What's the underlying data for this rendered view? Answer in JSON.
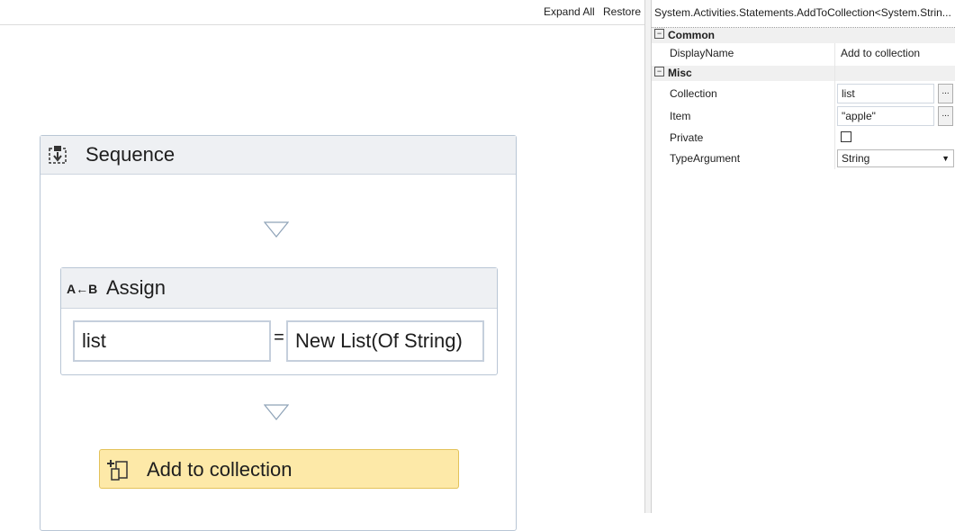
{
  "toolbar": {
    "expand_all": "Expand All",
    "restore": "Restore"
  },
  "sequence": {
    "title": "Sequence",
    "icon": "sequence-icon"
  },
  "assign": {
    "title": "Assign",
    "icon_text": "A←B",
    "to_value": "list",
    "equals": "=",
    "value": "New List(Of String)"
  },
  "add_to_collection": {
    "title": "Add to collection",
    "icon": "add-to-collection-icon"
  },
  "properties": {
    "title": "System.Activities.Statements.AddToCollection<System.Strin...",
    "categories": [
      {
        "label": "Common",
        "toggle": "⊟"
      },
      {
        "label": "Misc",
        "toggle": "⊟"
      }
    ],
    "display_name": {
      "label": "DisplayName",
      "value": "Add to collection"
    },
    "collection": {
      "label": "Collection",
      "value": "list",
      "button": "..."
    },
    "item": {
      "label": "Item",
      "value": "\"apple\"",
      "button": "..."
    },
    "private": {
      "label": "Private",
      "checked": false
    },
    "type_argument": {
      "label": "TypeArgument",
      "value": "String"
    }
  },
  "colors": {
    "activity_header": "#eef0f3",
    "activity_border": "#b9c6d5",
    "selected_activity": "#fde9a8",
    "selected_border": "#e3c25a"
  }
}
